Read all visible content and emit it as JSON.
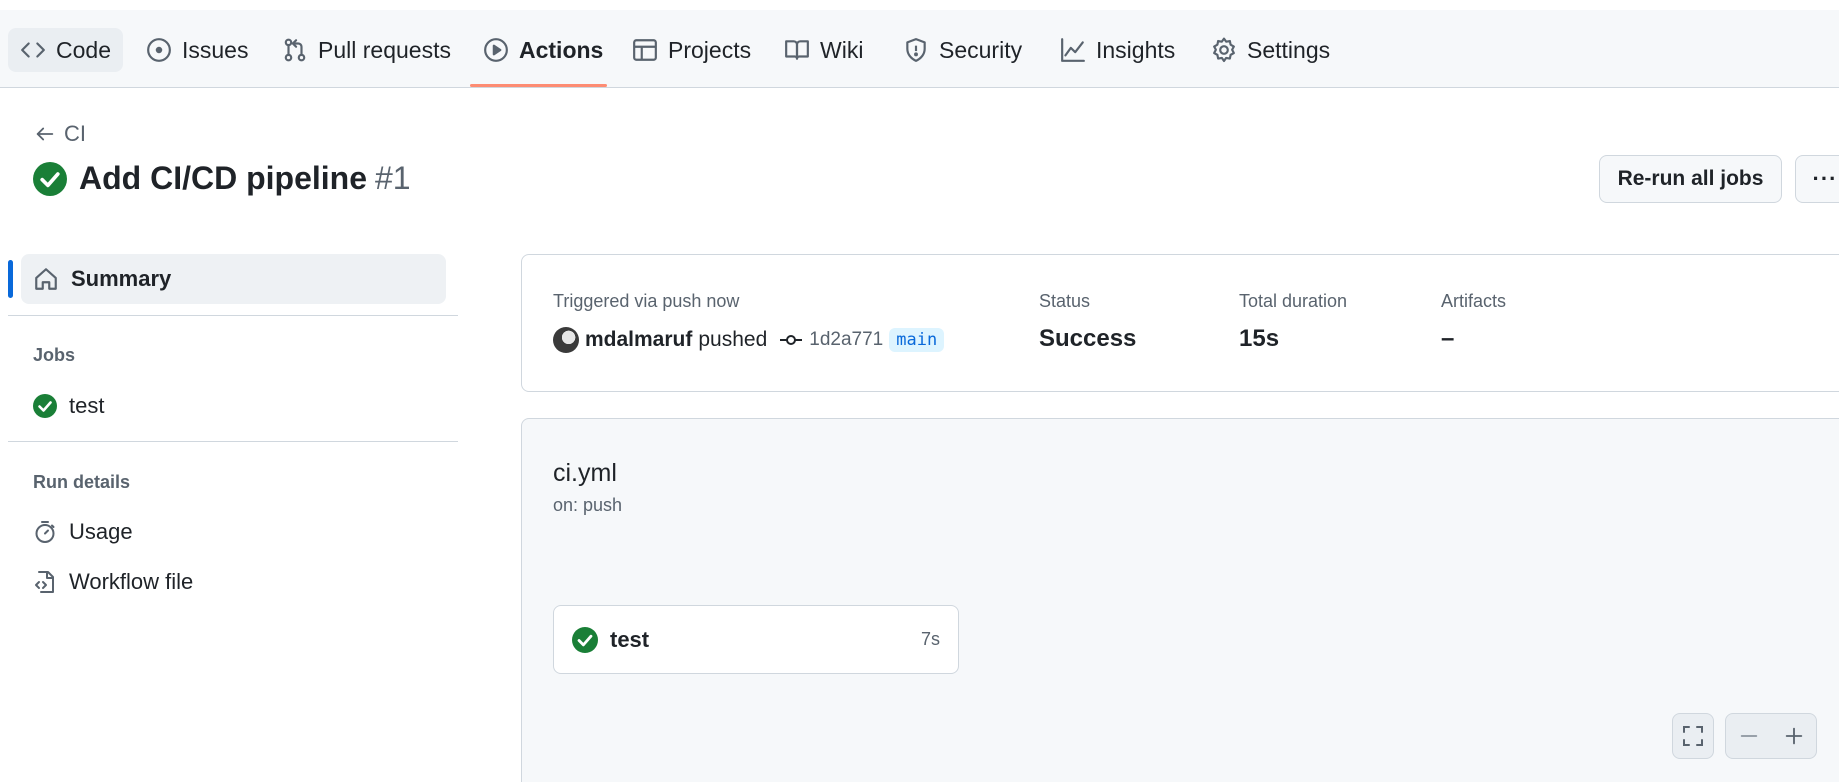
{
  "nav": {
    "tabs": [
      {
        "label": "Code",
        "icon": "code-icon"
      },
      {
        "label": "Issues",
        "icon": "issue-icon"
      },
      {
        "label": "Pull requests",
        "icon": "pull-request-icon"
      },
      {
        "label": "Actions",
        "icon": "play-icon",
        "active": true
      },
      {
        "label": "Projects",
        "icon": "table-icon"
      },
      {
        "label": "Wiki",
        "icon": "book-icon"
      },
      {
        "label": "Security",
        "icon": "shield-icon"
      },
      {
        "label": "Insights",
        "icon": "graph-icon"
      },
      {
        "label": "Settings",
        "icon": "gear-icon"
      }
    ]
  },
  "header": {
    "back_label": "CI",
    "title": "Add CI/CD pipeline",
    "run_number": "#1",
    "rerun_label": "Re-run all jobs",
    "more_label": "···"
  },
  "sidebar": {
    "summary_label": "Summary",
    "jobs_heading": "Jobs",
    "jobs": [
      {
        "label": "test",
        "status": "success"
      }
    ],
    "run_details_heading": "Run details",
    "details": [
      {
        "label": "Usage",
        "icon": "stopwatch-icon"
      },
      {
        "label": "Workflow file",
        "icon": "file-code-icon"
      }
    ]
  },
  "summary": {
    "trigger_label": "Triggered via push now",
    "user": "mdalmaruf",
    "action": "pushed",
    "commit_sha": "1d2a771",
    "branch": "main",
    "status_label": "Status",
    "status_value": "Success",
    "duration_label": "Total duration",
    "duration_value": "15s",
    "artifacts_label": "Artifacts",
    "artifacts_value": "–"
  },
  "workflow": {
    "file": "ci.yml",
    "trigger": "on: push",
    "job": {
      "name": "test",
      "duration": "7s"
    }
  },
  "colors": {
    "success": "#1a7f37",
    "accent": "#0969da",
    "active_tab": "#fd8c73"
  }
}
